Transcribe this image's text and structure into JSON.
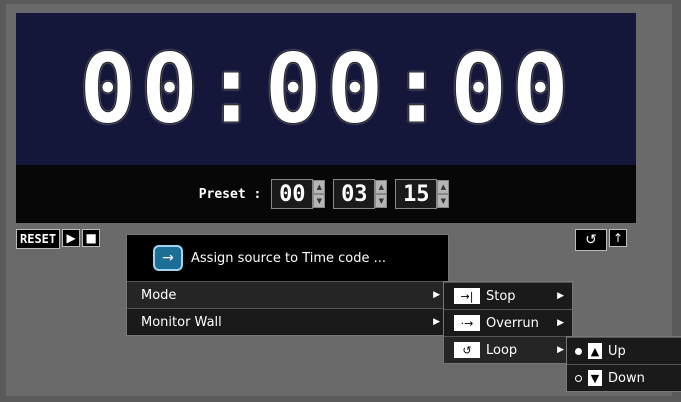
{
  "display": {
    "time": "00:00:00"
  },
  "preset": {
    "label": "Preset :",
    "hours": "00",
    "minutes": "03",
    "seconds": "15"
  },
  "controls": {
    "reset_label": "RESET",
    "play_glyph": "▶",
    "stop_glyph": "■",
    "loop_glyph": "↺",
    "up_glyph": "↑"
  },
  "context_menu": {
    "assign_label": "Assign source to Time code ...",
    "items": [
      {
        "label": "Mode"
      },
      {
        "label": "Monitor Wall"
      }
    ]
  },
  "mode_submenu": {
    "items": [
      {
        "label": "Stop",
        "icon": "stop-icon"
      },
      {
        "label": "Overrun",
        "icon": "overrun-icon"
      },
      {
        "label": "Loop",
        "icon": "loop-icon"
      }
    ]
  },
  "loop_submenu": {
    "items": [
      {
        "label": "Up",
        "selected": true
      },
      {
        "label": "Down",
        "selected": false
      }
    ]
  },
  "colors": {
    "display_bg": "#14163a",
    "assign_icon": "#1c6e96"
  }
}
